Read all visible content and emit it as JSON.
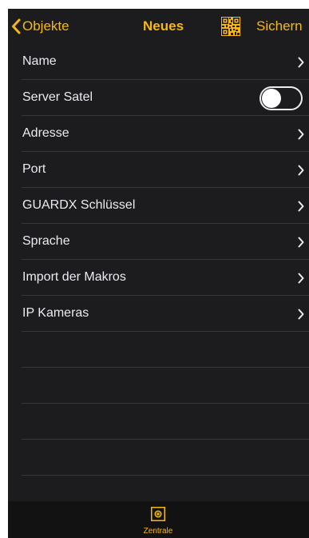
{
  "colors": {
    "accent": "#f5b814",
    "background": "#1c1c1e",
    "separator": "#38383b",
    "text": "#ebebf0"
  },
  "nav": {
    "back_label": "Objekte",
    "title": "Neues",
    "qr_icon": "qr-code-icon",
    "save_label": "Sichern"
  },
  "rows": [
    {
      "label": "Name",
      "accessory": "chevron"
    },
    {
      "label": "Server Satel",
      "accessory": "toggle",
      "toggle_on": false
    },
    {
      "label": "Adresse",
      "accessory": "chevron"
    },
    {
      "label": "Port",
      "accessory": "chevron"
    },
    {
      "label": "GUARDX Schlüssel",
      "accessory": "chevron"
    },
    {
      "label": "Sprache",
      "accessory": "chevron"
    },
    {
      "label": "Import der Makros",
      "accessory": "chevron"
    },
    {
      "label": "IP Kameras",
      "accessory": "chevron"
    }
  ],
  "tabbar": {
    "items": [
      {
        "label": "Zentrale",
        "icon": "control-panel-icon",
        "selected": true
      }
    ]
  }
}
